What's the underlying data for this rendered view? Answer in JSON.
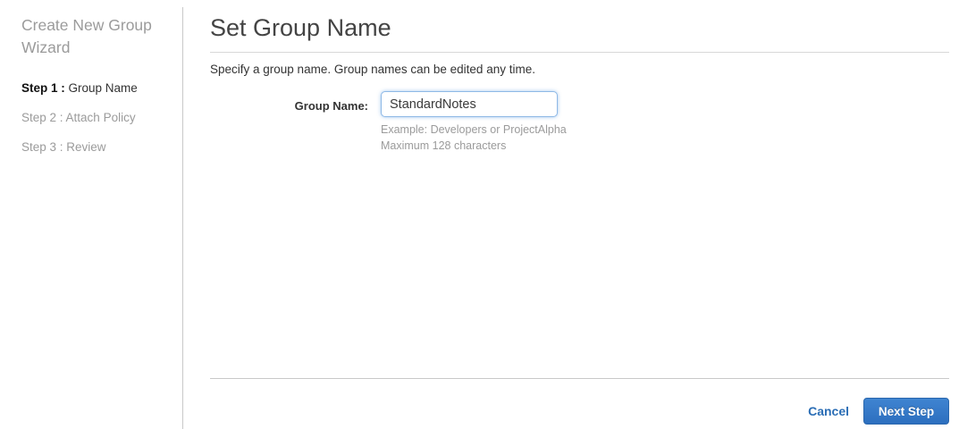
{
  "sidebar": {
    "title": "Create New Group Wizard",
    "steps": [
      {
        "prefix": "Step 1 : ",
        "label": "Group Name",
        "active": true
      },
      {
        "prefix": "Step 2 : ",
        "label": "Attach Policy",
        "active": false
      },
      {
        "prefix": "Step 3 : ",
        "label": "Review",
        "active": false
      }
    ]
  },
  "main": {
    "title": "Set Group Name",
    "description": "Specify a group name. Group names can be edited any time.",
    "form": {
      "group_name_label": "Group Name:",
      "group_name_value": "StandardNotes",
      "hint_line1": "Example: Developers or ProjectAlpha",
      "hint_line2": "Maximum 128 characters"
    },
    "footer": {
      "cancel_label": "Cancel",
      "next_label": "Next Step"
    }
  },
  "colors": {
    "accent_blue": "#2a6db5",
    "button_gradient_top": "#3f84d1",
    "button_gradient_bottom": "#2d6fbf",
    "muted_text": "#9b9b9b",
    "divider": "#c9c9c9"
  }
}
